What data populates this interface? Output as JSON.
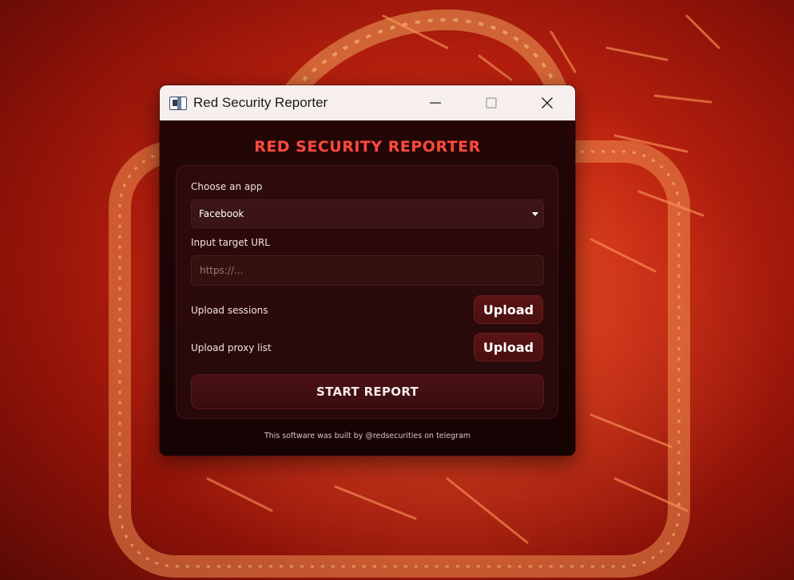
{
  "window": {
    "title": "Red Security Reporter",
    "controls": {
      "minimize_icon": "minimize-icon",
      "maximize_icon": "maximize-icon",
      "close_icon": "close-icon"
    }
  },
  "app": {
    "heading": "RED SECURITY REPORTER",
    "choose_app": {
      "label": "Choose an app",
      "selected": "Facebook"
    },
    "target_url": {
      "label": "Input target URL",
      "value": "",
      "placeholder": "https://..."
    },
    "sessions": {
      "label": "Upload sessions",
      "button": "Upload"
    },
    "proxy": {
      "label": "Upload proxy list",
      "button": "Upload"
    },
    "start_button": "START REPORT",
    "footer": "This software was built by @redsecurities on telegram"
  },
  "colors": {
    "accent": "#ff4a3d",
    "window_bg": "#1c0405",
    "button_bg": "#4a0f10",
    "titlebar_bg": "#f7eeee"
  }
}
